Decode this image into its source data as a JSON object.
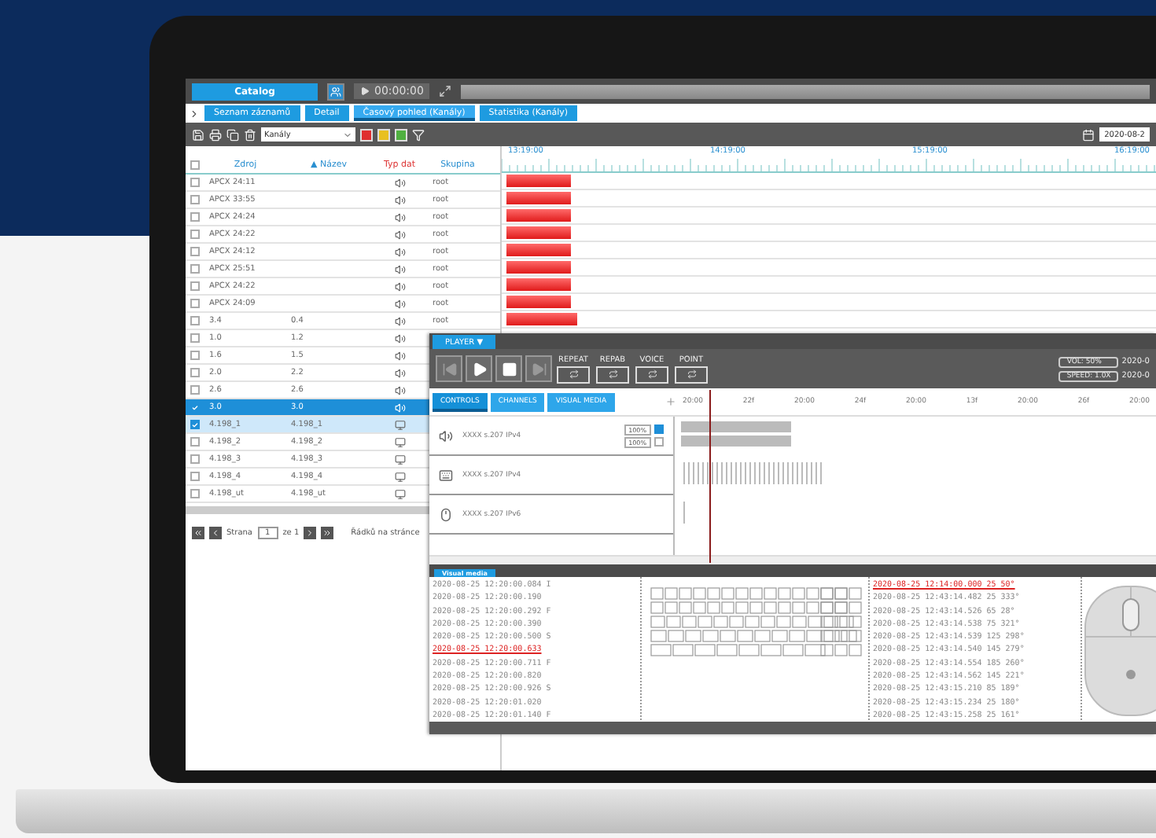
{
  "window": {
    "app_button": "Catalog",
    "time": "00:00:00"
  },
  "tabs": [
    {
      "label": "Seznam záznamů",
      "selected": false
    },
    {
      "label": "Detail",
      "selected": false
    },
    {
      "label": "Časový pohled (Kanály)",
      "selected": true
    },
    {
      "label": "Statistika (Kanály)",
      "selected": false
    }
  ],
  "toolbar": {
    "view_select": "Kanály",
    "date": "2020-08-2"
  },
  "table": {
    "all_checked": false,
    "columns": [
      "Zdroj",
      "▲ Název",
      "Typ dat",
      "Skupina"
    ],
    "rows": [
      {
        "source": "APCX 24:11",
        "name": "",
        "kind": "audio",
        "group": "root",
        "checked": false,
        "selected": false,
        "level": 0.1
      },
      {
        "source": "APCX 33:55",
        "name": "",
        "kind": "audio",
        "group": "root",
        "checked": false,
        "selected": false,
        "level": 0.1
      },
      {
        "source": "APCX 24:24",
        "name": "",
        "kind": "audio",
        "group": "root",
        "checked": false,
        "selected": false,
        "level": 0.1
      },
      {
        "source": "APCX 24:22",
        "name": "",
        "kind": "audio",
        "group": "root",
        "checked": false,
        "selected": false,
        "level": 0.1
      },
      {
        "source": "APCX 24:12",
        "name": "",
        "kind": "audio",
        "group": "root",
        "checked": false,
        "selected": false,
        "level": 0.1
      },
      {
        "source": "APCX 25:51",
        "name": "",
        "kind": "audio",
        "group": "root",
        "checked": false,
        "selected": false,
        "level": 0.1
      },
      {
        "source": "APCX 24:22",
        "name": "",
        "kind": "audio",
        "group": "root",
        "checked": false,
        "selected": false,
        "level": 0.1
      },
      {
        "source": "APCX 24:09",
        "name": "",
        "kind": "audio",
        "group": "root",
        "checked": false,
        "selected": false,
        "level": 0.1
      },
      {
        "source": "3.4",
        "name": "0.4",
        "kind": "audio",
        "group": "root",
        "checked": false,
        "selected": false,
        "level": 0.11
      },
      {
        "source": "1.0",
        "name": "1.2",
        "kind": "audio",
        "checked": false,
        "selected": false
      },
      {
        "source": "1.6",
        "name": "1.5",
        "kind": "audio",
        "checked": false,
        "selected": false
      },
      {
        "source": "2.0",
        "name": "2.2",
        "kind": "audio",
        "checked": false,
        "selected": false
      },
      {
        "source": "2.6",
        "name": "2.6",
        "kind": "audio",
        "checked": false,
        "selected": false
      },
      {
        "source": "3.0",
        "name": "3.0",
        "kind": "audio",
        "checked": true,
        "selected": true
      },
      {
        "source": "4.198_1",
        "name": "4.198_1",
        "kind": "video",
        "checked": true,
        "selected": false
      },
      {
        "source": "4.198_2",
        "name": "4.198_2",
        "kind": "video",
        "checked": false,
        "selected": false
      },
      {
        "source": "4.198_3",
        "name": "4.198_3",
        "kind": "video",
        "checked": false,
        "selected": false
      },
      {
        "source": "4.198_4",
        "name": "4.198_4",
        "kind": "video",
        "checked": false,
        "selected": false
      },
      {
        "source": "4.198_ut",
        "name": "4.198_ut",
        "kind": "video",
        "checked": false,
        "selected": false
      }
    ]
  },
  "timeline": {
    "ticks": [
      "13:19:00",
      "14:19:00",
      "15:19:00",
      "16:19:00"
    ]
  },
  "pagination": {
    "page_label": "Strana",
    "page": "1",
    "of_label": "ze 1",
    "rows_label": "Řádků na stránce"
  },
  "player": {
    "title": "PLAYER ▼",
    "modes": [
      "REPEAT",
      "REPAB",
      "VOICE",
      "POINT"
    ],
    "volume": "VOL: 50%",
    "speed": "SPEED: 1.0X",
    "dates": [
      "2020-0",
      "2020-0"
    ],
    "tabs": [
      {
        "label": "CONTROLS",
        "selected": true
      },
      {
        "label": "CHANNELS",
        "selected": false
      },
      {
        "label": "VISUAL MEDIA",
        "selected": false
      }
    ],
    "ticks": [
      "20:00",
      "22f",
      "20:00",
      "24f",
      "20:00",
      "13f",
      "20:00",
      "26f",
      "20:00"
    ],
    "channels": [
      {
        "kind": "audio",
        "name": "XXXX s.207 IPv4",
        "controls": [
          {
            "value": "100%",
            "on": true
          },
          {
            "value": "100%",
            "on": false
          }
        ]
      },
      {
        "kind": "keyboard",
        "name": "XXXX s.207 IPv4"
      },
      {
        "kind": "mouse",
        "name": "XXXX s.207 IPv6"
      }
    ]
  },
  "visual_media": {
    "title": "Visual media",
    "keys_log": [
      {
        "text": "2020-08-25 12:20:00.084 I",
        "highlighted": false
      },
      {
        "text": "2020-08-25 12:20:00.190",
        "highlighted": false
      },
      {
        "text": "2020-08-25 12:20:00.292 F",
        "highlighted": false
      },
      {
        "text": "2020-08-25 12:20:00.390",
        "highlighted": false
      },
      {
        "text": "2020-08-25 12:20:00.500 S",
        "highlighted": false
      },
      {
        "text": "2020-08-25 12:20:00.633",
        "highlighted": true
      },
      {
        "text": "2020-08-25 12:20:00.711 F",
        "highlighted": false
      },
      {
        "text": "2020-08-25 12:20:00.820",
        "highlighted": false
      },
      {
        "text": "2020-08-25 12:20:00.926 S",
        "highlighted": false
      },
      {
        "text": "2020-08-25 12:20:01.020",
        "highlighted": false
      },
      {
        "text": "2020-08-25 12:20:01.140 F",
        "highlighted": false
      }
    ],
    "mouse_log": [
      {
        "text": "2020-08-25 12:14:00.000 25 50°",
        "highlighted": true
      },
      {
        "text": "2020-08-25 12:43:14.482 25 333°",
        "highlighted": false
      },
      {
        "text": "2020-08-25 12:43:14.526 65 28°",
        "highlighted": false
      },
      {
        "text": "2020-08-25 12:43:14.538 75 321°",
        "highlighted": false
      },
      {
        "text": "2020-08-25 12:43:14.539 125 298°",
        "highlighted": false
      },
      {
        "text": "2020-08-25 12:43:14.540 145 279°",
        "highlighted": false
      },
      {
        "text": "2020-08-25 12:43:14.554 185 260°",
        "highlighted": false
      },
      {
        "text": "2020-08-25 12:43:14.562 145 221°",
        "highlighted": false
      },
      {
        "text": "2020-08-25 12:43:15.210 85 189°",
        "highlighted": false
      },
      {
        "text": "2020-08-25 12:43:15.234 25 180°",
        "highlighted": false
      },
      {
        "text": "2020-08-25 12:43:15.258 25 161°",
        "highlighted": false
      }
    ]
  }
}
